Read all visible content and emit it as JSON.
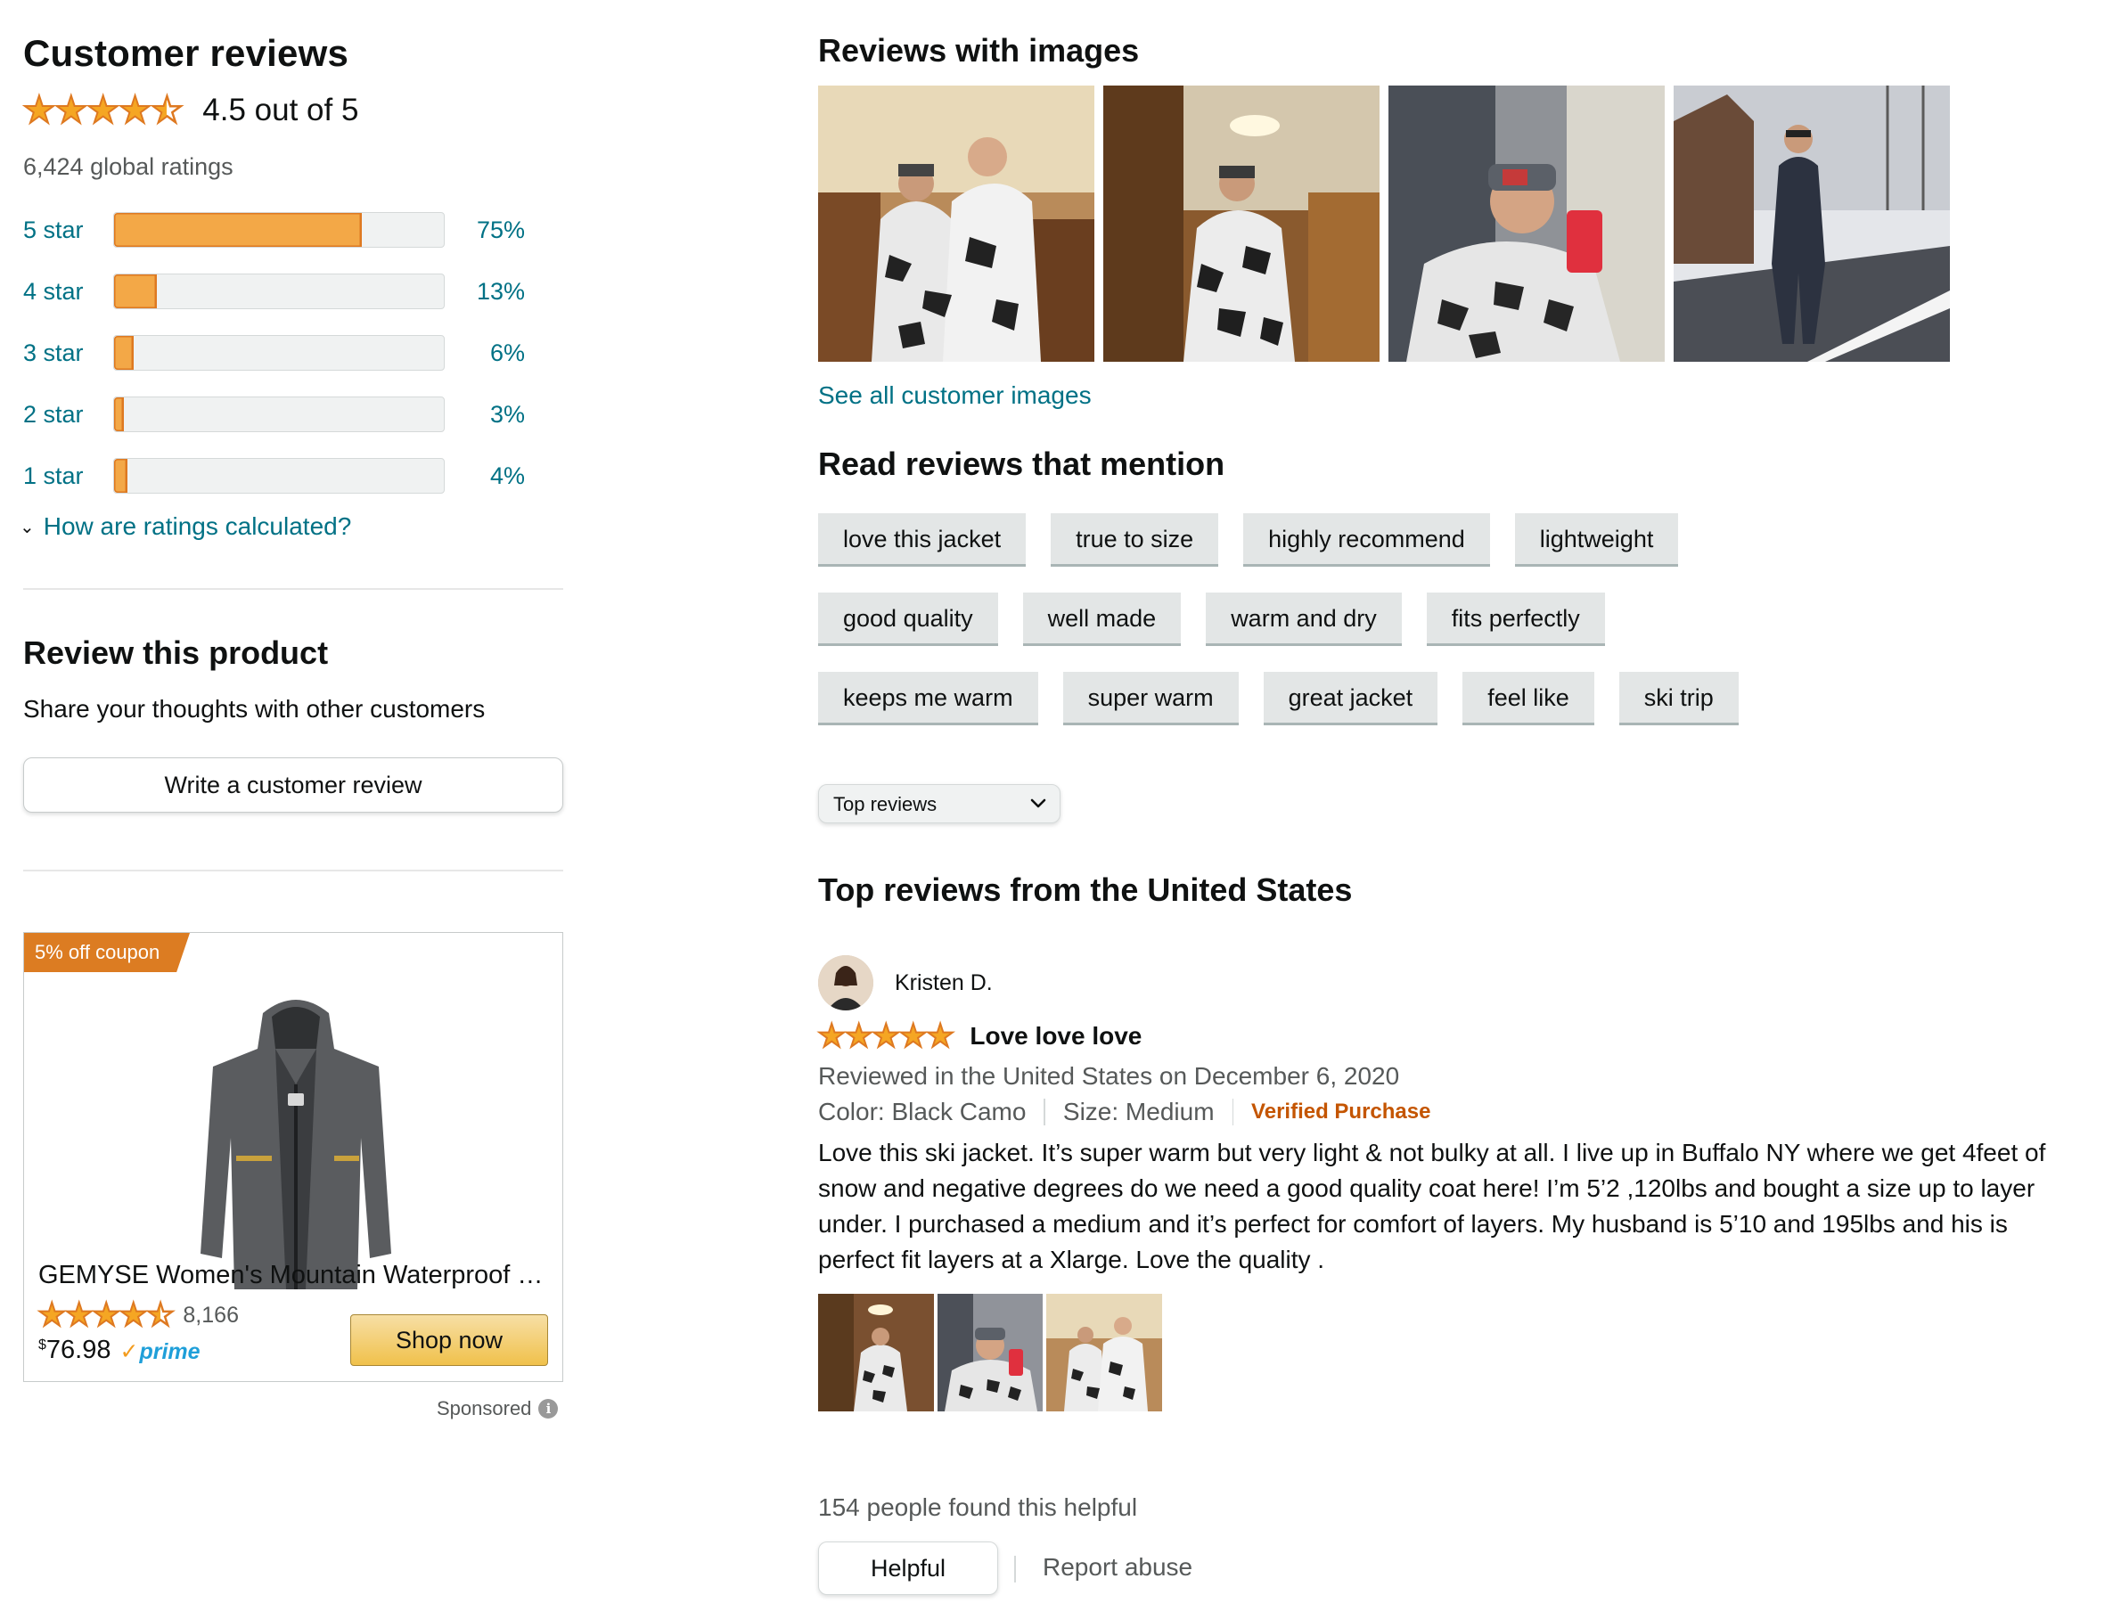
{
  "summary": {
    "title": "Customer reviews",
    "average_stars": 4.5,
    "average_text": "4.5 out of 5",
    "global_ratings": "6,424 global ratings",
    "histogram": [
      {
        "label": "5 star",
        "percent": 75,
        "percent_text": "75%"
      },
      {
        "label": "4 star",
        "percent": 13,
        "percent_text": "13%"
      },
      {
        "label": "3 star",
        "percent": 6,
        "percent_text": "6%"
      },
      {
        "label": "2 star",
        "percent": 3,
        "percent_text": "3%"
      },
      {
        "label": "1 star",
        "percent": 4,
        "percent_text": "4%"
      }
    ],
    "calc_link": "How are ratings calculated?"
  },
  "write_review": {
    "title": "Review this product",
    "subtitle": "Share your thoughts with other customers",
    "button": "Write a customer review"
  },
  "ad": {
    "coupon": "5% off coupon",
    "title": "GEMYSE Women's Mountain Waterproof S…",
    "stars": 4.5,
    "rating_count": "8,166",
    "price_symbol": "$",
    "price": "76.98",
    "prime": "prime",
    "button": "Shop now",
    "sponsored": "Sponsored"
  },
  "images_section": {
    "title": "Reviews with images",
    "see_all": "See all customer images"
  },
  "mentions": {
    "title": "Read reviews that mention",
    "rows": [
      [
        "love this jacket",
        "true to size",
        "highly recommend",
        "lightweight"
      ],
      [
        "good quality",
        "well made",
        "warm and dry",
        "fits perfectly"
      ],
      [
        "keeps me warm",
        "super warm",
        "great jacket",
        "feel like",
        "ski trip"
      ]
    ]
  },
  "sort": {
    "selected": "Top reviews"
  },
  "top_reviews": {
    "title": "Top reviews from the United States",
    "review": {
      "reviewer": "Kristen D.",
      "stars": 5,
      "headline": "Love love love",
      "date": "Reviewed in the United States on December 6, 2020",
      "color": "Color: Black Camo",
      "size": "Size: Medium",
      "verified": "Verified Purchase",
      "body": "Love this ski jacket. It’s super warm but very light & not bulky at all. I live up in Buffalo NY where we get 4feet of snow and negative degrees do we need a good quality coat here! I’m 5’2 ,120lbs and bought a size up to layer under. I purchased a medium and it’s perfect for comfort of layers. My husband is 5’10 and 195lbs and his is perfect fit layers at a Xlarge. Love the quality .",
      "helpful_count": "154 people found this helpful",
      "helpful_button": "Helpful",
      "report": "Report abuse"
    }
  },
  "colors": {
    "link": "#007185",
    "star": "#f5a623",
    "bar_fill": "#f3a847",
    "verified": "#c45500",
    "coupon": "#dc7c22"
  },
  "icons": {
    "stars": "star-rating-icon",
    "chevron": "chevron-down-icon",
    "info": "info-icon",
    "prime": "prime-check-icon"
  }
}
